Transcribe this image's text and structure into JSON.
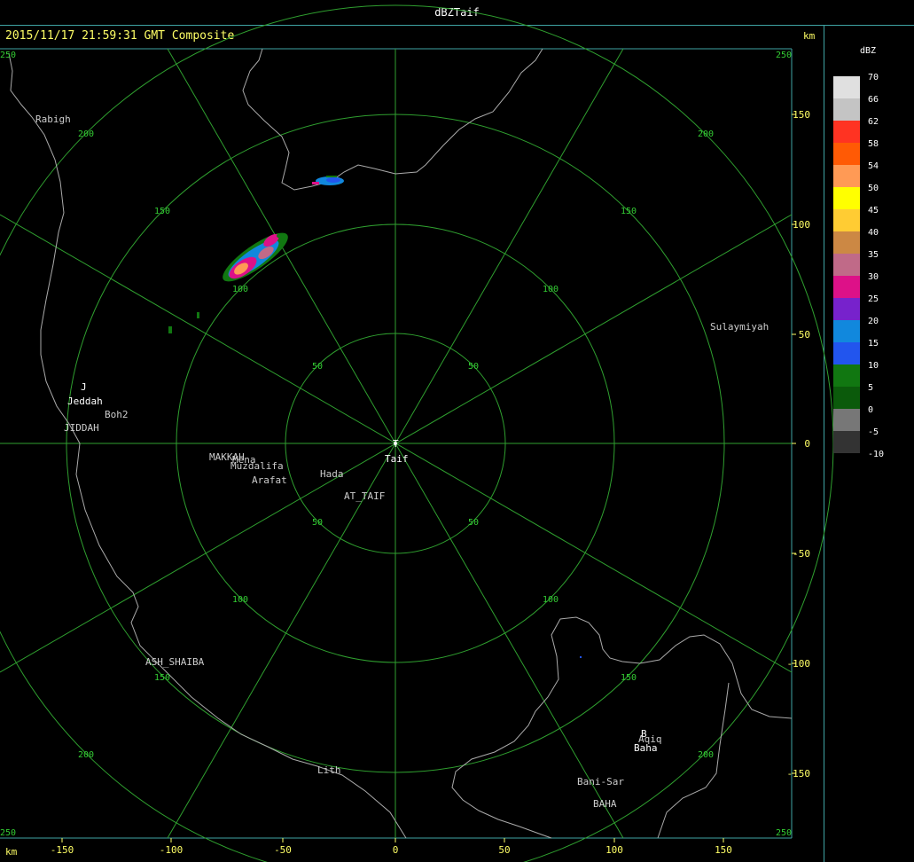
{
  "window": {
    "title": "dBZTaif"
  },
  "header": {
    "timestamp": "2015/11/17 21:59:31 GMT Composite",
    "km_label": "km"
  },
  "bottom_km_label": "km",
  "colors": {
    "grid": "#2f9f2f",
    "ring_label": "#33cc33",
    "axis_label": "#ffff66",
    "coast": "#aaaaaa",
    "frame": "#3fa3a3"
  },
  "legend": {
    "title": "dBZ",
    "bins": [
      {
        "label": "70",
        "color": "#e0e0e0"
      },
      {
        "label": "66",
        "color": "#c4c4c4"
      },
      {
        "label": "62",
        "color": "#ff3322"
      },
      {
        "label": "58",
        "color": "#ff5a05"
      },
      {
        "label": "54",
        "color": "#ff9a55"
      },
      {
        "label": "50",
        "color": "#ffff00"
      },
      {
        "label": "45",
        "color": "#ffcc33"
      },
      {
        "label": "40",
        "color": "#cc8844"
      },
      {
        "label": "35",
        "color": "#c06a88"
      },
      {
        "label": "30",
        "color": "#dd1188"
      },
      {
        "label": "25",
        "color": "#7722cc"
      },
      {
        "label": "20",
        "color": "#1188dd"
      },
      {
        "label": "15",
        "color": "#2255ee"
      },
      {
        "label": "10",
        "color": "#117711"
      },
      {
        "label": "5",
        "color": "#0b5a0b"
      },
      {
        "label": "0",
        "color": "#777777"
      },
      {
        "label": "-5",
        "color": "#333333"
      },
      {
        "label": "-10",
        "color": ""
      }
    ]
  },
  "axes": {
    "x_ticks": [
      "-150",
      "-100",
      "-50",
      "0",
      "50",
      "100",
      "150"
    ],
    "y_ticks": [
      "150",
      "100",
      "50",
      "0",
      "-50",
      "-100",
      "-150"
    ],
    "corner_labels": [
      "250",
      "250",
      "250",
      "250"
    ]
  },
  "rings": [
    {
      "range": "50",
      "labels": [
        "50",
        "50",
        "50",
        "50"
      ]
    },
    {
      "range": "100",
      "labels": [
        "100",
        "100",
        "100",
        "100"
      ]
    },
    {
      "range": "150",
      "labels": [
        "150",
        "150",
        "150",
        "150"
      ]
    },
    {
      "range": "200",
      "labels": [
        "200",
        "200",
        "200",
        "200"
      ]
    }
  ],
  "places": {
    "rabigh": "Rabigh",
    "jeddah_marker": "J",
    "jeddah": "Jeddah",
    "boh2": "Boh2",
    "jiddah": "JIDDAH",
    "makkah": "MAKKAH",
    "mena": "Mena",
    "muzdalifa": "Muzdalifa",
    "arafat": "Arafat",
    "hada": "Hada",
    "at_taif": "AT_TAIF",
    "taif_marker": "T",
    "taif": "Taif",
    "sulaymiyah": "Sulaymiyah",
    "ash_shaiba": "ASH_SHAIBA",
    "lith": "Lith",
    "baha_marker": "B",
    "aqiq": "Aqiq",
    "baha": "Baha",
    "bani_sar": "Bani-Sar",
    "baha_caps": "BAHA"
  }
}
